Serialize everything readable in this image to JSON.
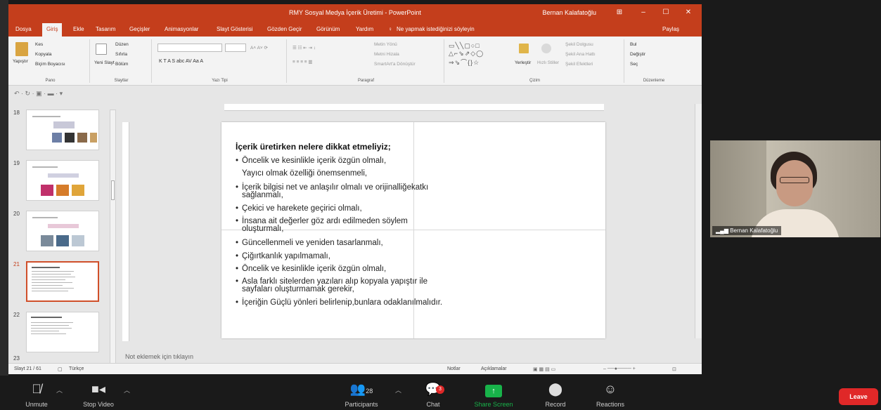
{
  "window": {
    "title": "RMY Sosyal Medya İçerik Üretimi - PowerPoint",
    "user": "Bernan Kalafatoğlu",
    "controls": [
      "⊞",
      "–",
      "☐",
      "✕"
    ]
  },
  "ribbon_tabs": [
    "Dosya",
    "Giriş",
    "Ekle",
    "Tasarım",
    "Geçişler",
    "Animasyonlar",
    "Slayt Gösterisi",
    "Gözden Geçir",
    "Görünüm",
    "Yardım"
  ],
  "tell_me": "Ne yapmak istediğinizi söyleyin",
  "share_label": "Paylaş",
  "ribbon": {
    "clipboard": {
      "paste": "Yapıştır",
      "cut": "Kes",
      "copy": "Kopyala",
      "painter": "Biçim Boyacısı",
      "group": "Pano"
    },
    "slides": {
      "new_slide": "Yeni Slayt",
      "layout": "Düzen",
      "reset": "Sıfırla",
      "section": "Bölüm",
      "group": "Slaytlar"
    },
    "font": {
      "group": "Yazı Tipi",
      "tools": "K  T  A  S  abc  AV  Aa  A"
    },
    "paragraph": {
      "group": "Paragraf",
      "text_dir": "Metin Yönü",
      "align_text": "Metni Hizala",
      "smartart": "SmartArt'a Dönüştür"
    },
    "drawing": {
      "arrange": "Yerleştir",
      "quick_styles": "Hızlı Stiller",
      "fill": "Şekil Dolgusu",
      "outline": "Şekil Ana Hattı",
      "effects": "Şekil Efektleri",
      "group": "Çizim"
    },
    "editing": {
      "find": "Bul",
      "replace": "Değiştir",
      "select": "Seç",
      "group": "Düzenleme"
    }
  },
  "thumbnails": [
    {
      "num": "18",
      "selected": false
    },
    {
      "num": "19",
      "selected": false
    },
    {
      "num": "20",
      "selected": false
    },
    {
      "num": "21",
      "selected": true
    },
    {
      "num": "22",
      "selected": false
    },
    {
      "num": "23",
      "selected": false
    }
  ],
  "slide": {
    "title": "İçerik üretirken nelere dikkat etmeliyiz;",
    "bullets": [
      {
        "bullet": "•",
        "text": "Öncelik ve kesinlikle içerik özgün olmalı,"
      },
      {
        "bullet": "",
        "text": "Yayıcı olmak özelliği önemsenmeli,"
      },
      {
        "bullet": "•",
        "text": "İçerik bilgisi net ve anlaşılır olmalı ve orijinalliğekatkı"
      },
      {
        "bullet": "",
        "text": "sağlanmalı,"
      },
      {
        "bullet": "•",
        "text": "Çekici ve harekete geçirici olmalı,"
      },
      {
        "bullet": "•",
        "text": "İnsana ait değerler göz ardı edilmeden söylem"
      },
      {
        "bullet": "",
        "text": "oluşturmalı,"
      },
      {
        "bullet": "•",
        "text": "Güncellenmeli ve yeniden tasarlanmalı,"
      },
      {
        "bullet": "•",
        "text": "Çiğırtkanlık yapılmamalı,"
      },
      {
        "bullet": "•",
        "text": "Öncelik ve kesinlikle içerik özgün olmalı,"
      },
      {
        "bullet": "•",
        "text": "Asla farklı sitelerden yazıları alıp kopyala yapıştır ile"
      },
      {
        "bullet": "",
        "text": "sayfaları oluşturmamak gerekir,"
      },
      {
        "bullet": "•",
        "text": "İçeriğin Güçlü yönleri belirlenip,bunlara odaklanılmalıdır."
      }
    ]
  },
  "notes_placeholder": "Not eklemek için tıklayın",
  "status": {
    "slide": "Slayt 21 / 61",
    "lang": "Türkçe",
    "notes": "Notlar",
    "comments": "Açıklamalar"
  },
  "video": {
    "name": "Bernan Kalafatoğlu"
  },
  "zoom": {
    "unmute": "Unmute",
    "stop_video": "Stop Video",
    "participants": "Participants",
    "participants_count": "28",
    "chat": "Chat",
    "chat_badge": "3",
    "share_screen": "Share Screen",
    "record": "Record",
    "reactions": "Reactions",
    "leave": "Leave"
  }
}
